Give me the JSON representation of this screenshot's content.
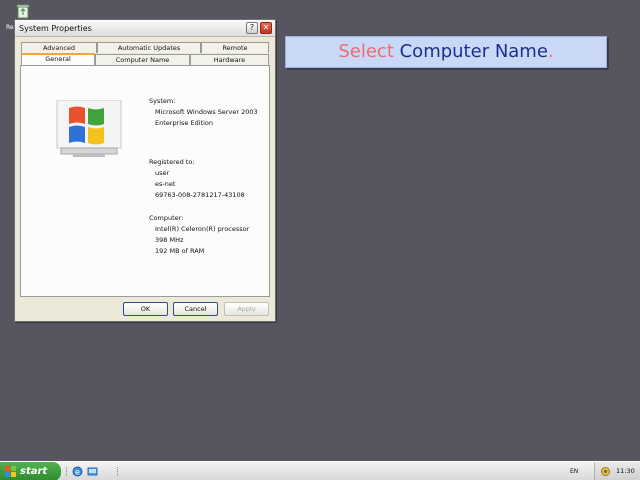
{
  "desktop": {
    "recycle_bin_label": "Re"
  },
  "window": {
    "title": "System Properties",
    "help_label": "?",
    "close_label": "✕",
    "tabs_top": [
      "Advanced",
      "Automatic Updates",
      "Remote"
    ],
    "tabs_bottom": [
      "General",
      "Computer Name",
      "Hardware"
    ],
    "active_tab": "General",
    "system": {
      "heading": "System:",
      "os": "Microsoft Windows Server 2003",
      "edition": "Enterprise Edition"
    },
    "registered": {
      "heading": "Registered to:",
      "user": "user",
      "org": "es-net",
      "product_id": "69763-008-2781217-43108"
    },
    "computer": {
      "heading": "Computer:",
      "cpu": "Intel(R) Celeron(R) processor",
      "speed": "398 MHz",
      "ram": "192 MB of RAM"
    },
    "buttons": {
      "ok": "OK",
      "cancel": "Cancel",
      "apply": "Apply"
    }
  },
  "instruction": {
    "verb": "Select",
    "target": "Computer Name",
    "punct": "."
  },
  "taskbar": {
    "start_label": "start",
    "language": "EN",
    "clock": "11:30"
  },
  "colors": {
    "desktop": "#57555f",
    "banner_bg": "#c9d8f7",
    "banner_verb": "#f06a70",
    "banner_target": "#1d2f8c",
    "start_green": "#3a9a3a"
  }
}
